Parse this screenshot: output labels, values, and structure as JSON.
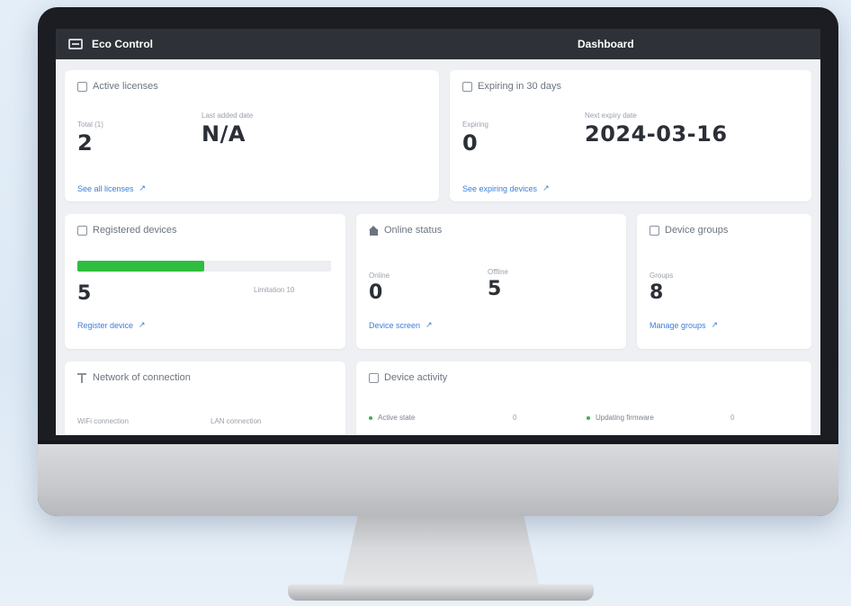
{
  "app": {
    "name": "Eco Control",
    "page_title": "Dashboard"
  },
  "active_licenses": {
    "title": "Active licenses",
    "total_label": "Total (1)",
    "total_value": "2",
    "last_label": "Last added date",
    "last_value": "N/A",
    "link": "See all licenses"
  },
  "expiring": {
    "title": "Expiring in 30 days",
    "count_label": "Expiring",
    "count_value": "0",
    "date_label": "Next expiry date",
    "date_value": "2024-03-16",
    "link": "See expiring devices"
  },
  "registered_devices": {
    "title": "Registered devices",
    "value": "5",
    "limit_label": "Limitation 10",
    "progress_percent": 50,
    "link": "Register device"
  },
  "online_status": {
    "title": "Online status",
    "online_label": "Online",
    "online_value": "0",
    "offline_label": "Offline",
    "offline_value": "5",
    "link": "Device screen"
  },
  "device_groups": {
    "title": "Device groups",
    "count_label": "Groups",
    "count_value": "8",
    "link": "Manage groups"
  },
  "network": {
    "title": "Network of connection",
    "wifi_label": "WiFi connection",
    "lan_label": "LAN connection"
  },
  "device_activity": {
    "title": "Device activity",
    "items": [
      {
        "label": "Active state",
        "count": "0"
      },
      {
        "label": "Updating firmware",
        "count": "0"
      }
    ]
  },
  "colors": {
    "accent": "#3b7ed8",
    "progress": "#2ebd3e",
    "titlebar": "#2e3138"
  }
}
